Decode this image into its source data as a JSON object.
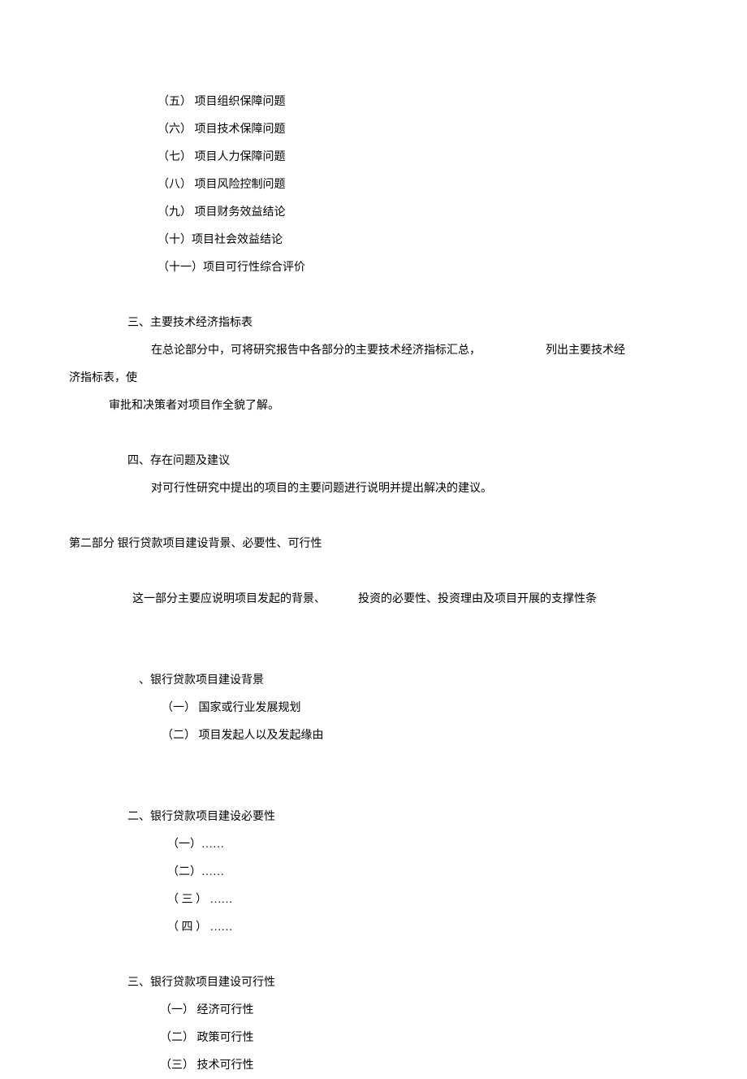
{
  "section_a": {
    "items": [
      "（五） 项目组织保障问题",
      "（六） 项目技术保障问题",
      "（七） 项目人力保障问题",
      "（八） 项目风险控制问题",
      "（九） 项目财务效益结论",
      "（十）项目社会效益结论",
      "（十一）项目可行性综合评价"
    ]
  },
  "section_3": {
    "heading": "三、主要技术经济指标表",
    "body_1a": "在总论部分中，可将研究报告中各部分的主要技术经济指标汇总，",
    "body_1b": "列出主要技术经",
    "body_2": "济指标表，使",
    "body_3": "审批和决策者对项目作全貌了解。"
  },
  "section_4": {
    "heading": "四、存在问题及建议",
    "body": "对可行性研究中提出的项目的主要问题进行说明并提出解决的建议。"
  },
  "part2": {
    "title": "第二部分 银行贷款项目建设背景、必要性、可行性",
    "intro_a": "这一部分主要应说明项目发起的背景、",
    "intro_b": "投资的必要性、投资理由及项目开展的支撑性条",
    "sec1": {
      "heading": "、银行贷款项目建设背景",
      "items": [
        "（一） 国家或行业发展规划",
        "（二） 项目发起人以及发起缘由"
      ]
    },
    "sec2": {
      "heading": "二、银行贷款项目建设必要性",
      "items": [
        "（一）……",
        "（二）……",
        "（ 三 ）  ……",
        "（ 四 ）  ……"
      ]
    },
    "sec3": {
      "heading": "三、银行贷款项目建设可行性",
      "items": [
        "（一） 经济可行性",
        "（二） 政策可行性",
        "（三） 技术可行性"
      ]
    }
  }
}
